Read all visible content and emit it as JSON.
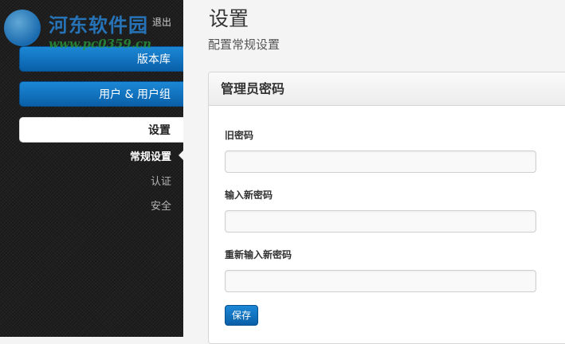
{
  "sidebar": {
    "logout_label": "退出",
    "repos_label": "版本库",
    "users_label": "用户 & 用户组",
    "settings_label": "设置",
    "sub_items": [
      "常规设置",
      "认证",
      "安全"
    ]
  },
  "watermark": {
    "brand": "河东软件园",
    "url": "www.pc0359.cn"
  },
  "header": {
    "title": "设置",
    "subtitle": "配置常规设置"
  },
  "panel": {
    "title": "管理员密码",
    "old_password_label": "旧密码",
    "new_password_label": "输入新密码",
    "confirm_password_label": "重新输入新密码",
    "old_password_value": "",
    "new_password_value": "",
    "confirm_password_value": "",
    "save_label": "保存"
  },
  "colors": {
    "accent": "#0a6ab8",
    "sidebar_bg": "#1f1f1f"
  }
}
